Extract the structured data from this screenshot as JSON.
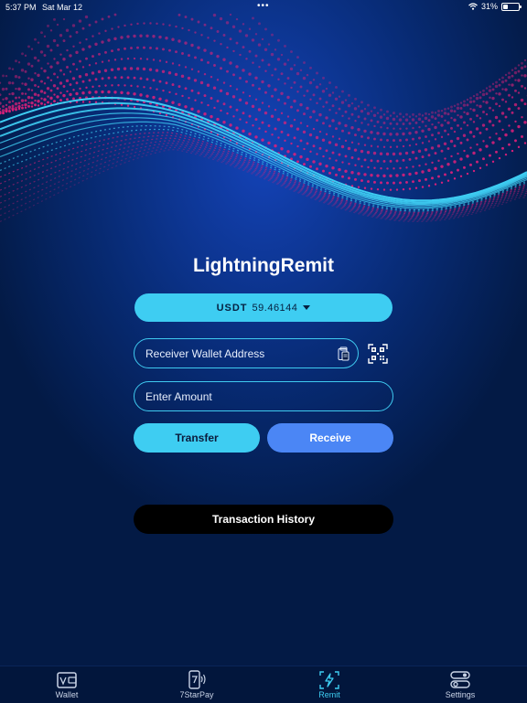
{
  "status": {
    "time": "5:37 PM",
    "date": "Sat Mar 12",
    "battery": "31%",
    "battery_level": 0.31
  },
  "app_title": "LightningRemit",
  "currency": {
    "symbol": "USDT",
    "balance": "59.46144"
  },
  "receiver_field": {
    "placeholder": "Receiver Wallet Address"
  },
  "amount_field": {
    "placeholder": "Enter Amount"
  },
  "buttons": {
    "transfer": "Transfer",
    "receive": "Receive",
    "history": "Transaction History"
  },
  "tabs": [
    {
      "label": "Wallet",
      "icon": "wallet-icon"
    },
    {
      "label": "7StarPay",
      "icon": "phone-pay-icon"
    },
    {
      "label": "Remit",
      "icon": "lightning-icon"
    },
    {
      "label": "Settings",
      "icon": "toggles-icon"
    }
  ],
  "active_tab": "Remit",
  "colors": {
    "background": "#031a45",
    "accent_cyan": "#3ecdf2",
    "accent_blue": "#4b86f5",
    "wave_pink": "#e0207a"
  }
}
